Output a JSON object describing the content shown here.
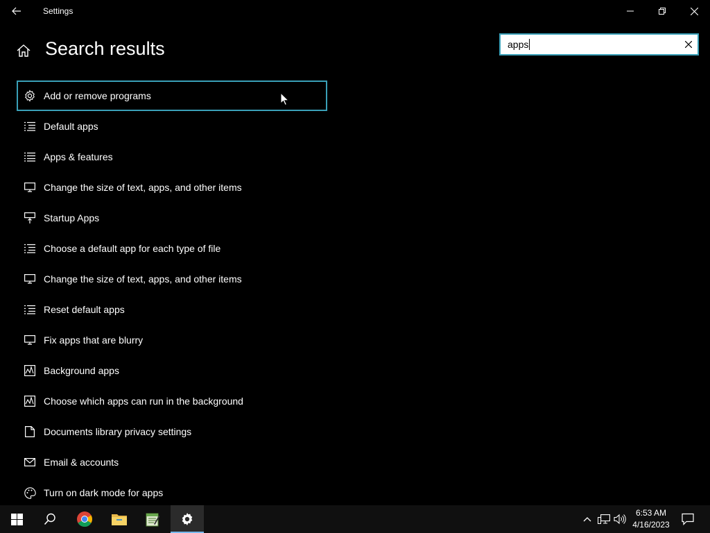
{
  "window": {
    "title": "Settings"
  },
  "page": {
    "title": "Search results"
  },
  "search": {
    "value": "apps",
    "clear_icon": "close-icon"
  },
  "results": [
    {
      "label": "Add or remove programs",
      "icon": "gear-icon",
      "selected": true
    },
    {
      "label": "Default apps",
      "icon": "list-icon"
    },
    {
      "label": "Apps & features",
      "icon": "list-icon"
    },
    {
      "label": "Change the size of text, apps, and other items",
      "icon": "monitor-icon"
    },
    {
      "label": "Startup Apps",
      "icon": "startup-icon"
    },
    {
      "label": "Choose a default app for each type of file",
      "icon": "list-icon"
    },
    {
      "label": "Change the size of text, apps, and other items",
      "icon": "monitor-icon"
    },
    {
      "label": "Reset default apps",
      "icon": "list-icon"
    },
    {
      "label": "Fix apps that are blurry",
      "icon": "monitor-icon"
    },
    {
      "label": "Background apps",
      "icon": "activity-icon"
    },
    {
      "label": "Choose which apps can run in the background",
      "icon": "activity-icon"
    },
    {
      "label": "Documents library privacy settings",
      "icon": "document-icon"
    },
    {
      "label": "Email & accounts",
      "icon": "mail-icon"
    },
    {
      "label": "Turn on dark mode for apps",
      "icon": "palette-icon"
    }
  ],
  "taskbar": {
    "time": "6:53 AM",
    "date": "4/16/2023",
    "apps": [
      "start",
      "search",
      "chrome",
      "file-explorer",
      "notepad",
      "settings"
    ]
  },
  "colors": {
    "accent": "#3aa0b8",
    "background": "#000000",
    "taskbar": "#101010"
  }
}
